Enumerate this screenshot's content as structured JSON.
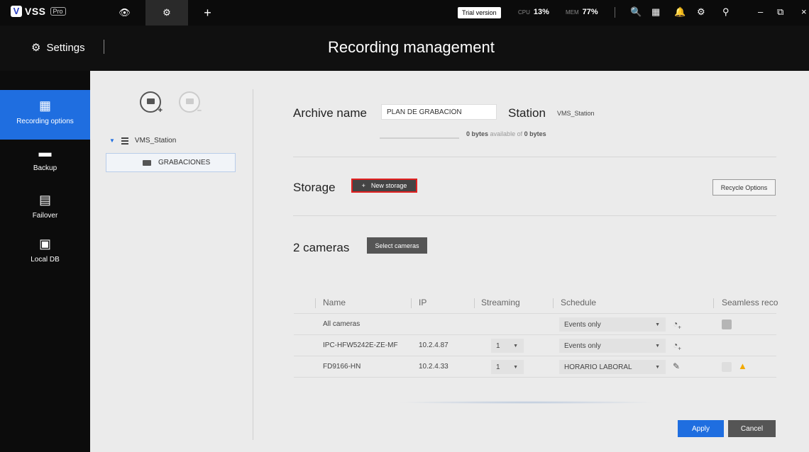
{
  "app": {
    "logo_mark": "V",
    "name": "VSS",
    "edition": "Pro"
  },
  "topbar": {
    "tabs": [
      {
        "icon": "eye-icon",
        "glyph": "👁"
      },
      {
        "icon": "gear-icon",
        "glyph": "⚙"
      },
      {
        "icon": "plus-icon",
        "glyph": "+"
      }
    ],
    "trial": "Trial version",
    "cpu_label": "CPU",
    "cpu_value": "13%",
    "mem_label": "MEM",
    "mem_value": "77%",
    "icons": [
      {
        "name": "search-icon",
        "glyph": "🔍"
      },
      {
        "name": "grid-icon",
        "glyph": "▦"
      },
      {
        "name": "bell-icon",
        "glyph": "🔔"
      },
      {
        "name": "settings-icon",
        "glyph": "⚙"
      },
      {
        "name": "pin-icon",
        "glyph": "⚲"
      }
    ],
    "window_controls": [
      "–",
      "⧉",
      "×"
    ]
  },
  "header": {
    "settings_label": "Settings",
    "page_title": "Recording management"
  },
  "leftnav": {
    "items": [
      {
        "label": "Recording options",
        "icon": "calendar-icon",
        "glyph": "▦"
      },
      {
        "label": "Backup",
        "icon": "backup-icon",
        "glyph": "▬"
      },
      {
        "label": "Failover",
        "icon": "failover-icon",
        "glyph": "▤"
      },
      {
        "label": "Local DB",
        "icon": "folder-icon",
        "glyph": "▣"
      }
    ]
  },
  "tree": {
    "root_label": "VMS_Station",
    "child_label": "GRABACIONES"
  },
  "archive": {
    "label": "Archive name",
    "value": "PLAN DE GRABACIÓN",
    "station_label": "Station",
    "station_value": "VMS_Station",
    "capacity_used": "0 bytes",
    "capacity_mid": "available of",
    "capacity_total": "0 bytes"
  },
  "storage": {
    "label": "Storage",
    "new_button_plus": "+",
    "new_button": "New storage",
    "recycle_button": "Recycle Options"
  },
  "cameras": {
    "label": "2 cameras",
    "select_button": "Select cameras",
    "columns": {
      "name": "Name",
      "ip": "IP",
      "streaming": "Streaming",
      "schedule": "Schedule",
      "seamless": "Seamless reco"
    },
    "all_row": {
      "name": "All cameras",
      "schedule": "Events only"
    },
    "rows": [
      {
        "name": "IPC-HFW5242E-ZE-MF",
        "ip": "10.2.4.87",
        "streaming": "1",
        "schedule": "Events only"
      },
      {
        "name": "FD9166-HN",
        "ip": "10.2.4.33",
        "streaming": "1",
        "schedule": "HORARIO LABORAL"
      }
    ]
  },
  "footer": {
    "apply": "Apply",
    "cancel": "Cancel"
  }
}
